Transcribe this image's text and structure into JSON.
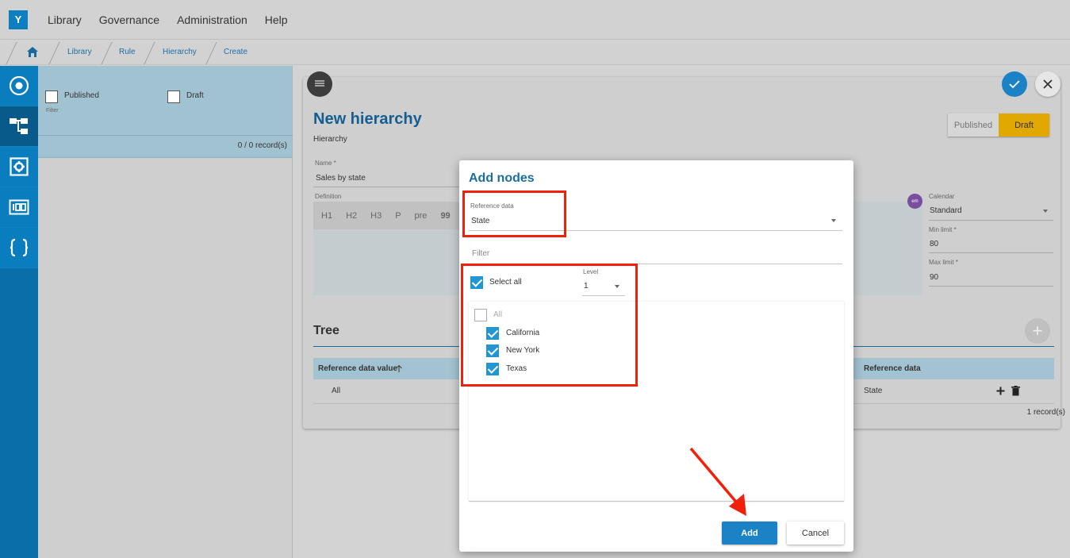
{
  "nav": {
    "logo": "Y",
    "items": [
      "Library",
      "Governance",
      "Administration",
      "Help"
    ]
  },
  "breadcrumb": [
    "Library",
    "Rule",
    "Hierarchy",
    "Create"
  ],
  "rail": {
    "icons": [
      "target-icon",
      "hierarchy-icon",
      "gear-box-icon",
      "counter-icon",
      "braces-icon"
    ]
  },
  "left_panel": {
    "published_label": "Published",
    "draft_label": "Draft",
    "filter_label": "Filter",
    "records": "0 / 0 record(s)"
  },
  "page": {
    "title": "New hierarchy",
    "subtitle": "Hierarchy",
    "status_published": "Published",
    "status_draft": "Draft",
    "name_label": "Name *",
    "name_value": "Sales by state",
    "definition_label": "Definition",
    "editor_buttons": [
      "H1",
      "H2",
      "H3",
      "P",
      "pre",
      "99"
    ],
    "avatar_text": "em",
    "calendar_label": "Calendar",
    "calendar_value": "Standard",
    "min_label": "Min limit *",
    "min_value": "80",
    "max_label": "Max limit *",
    "max_value": "90",
    "tree_title": "Tree",
    "tree_col1": "Reference data value",
    "tree_col2": "Reference data",
    "tree_row_value": "All",
    "tree_row_ref": "State",
    "tree_records": "1 record(s)"
  },
  "modal": {
    "title": "Add nodes",
    "ref_label": "Reference data",
    "ref_value": "State",
    "filter_placeholder": "Filter",
    "select_all": "Select all",
    "level_label": "Level",
    "level_value": "1",
    "items": [
      {
        "label": "All",
        "checked": false
      },
      {
        "label": "California",
        "checked": true
      },
      {
        "label": "New York",
        "checked": true
      },
      {
        "label": "Texas",
        "checked": true
      }
    ],
    "add_label": "Add",
    "cancel_label": "Cancel"
  },
  "colors": {
    "accent": "#1b82c5",
    "rail": "#0a7dbf",
    "draft": "#e0a800",
    "highlight": "#f0200a"
  }
}
